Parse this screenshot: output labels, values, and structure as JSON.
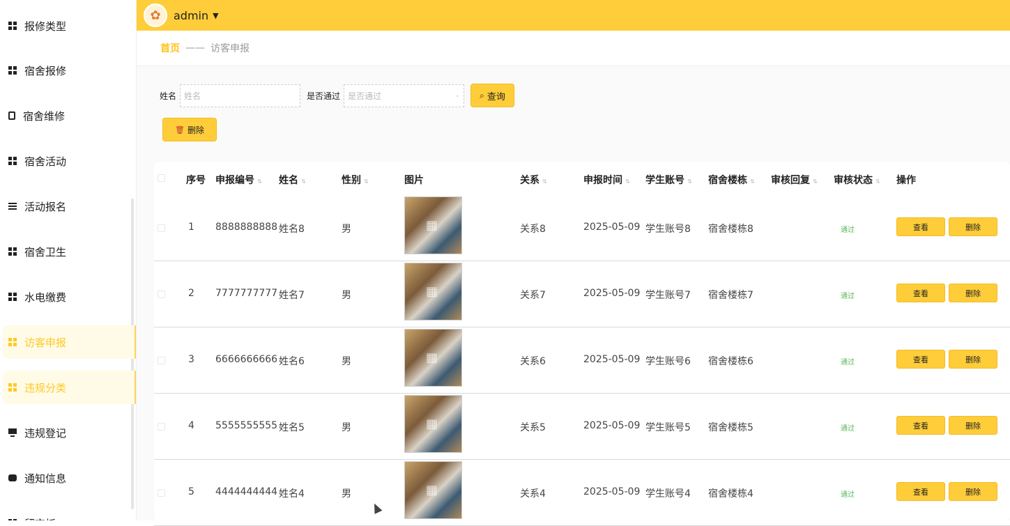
{
  "sidebar": {
    "items": [
      {
        "label": "报修类型",
        "icon": "grid-icon"
      },
      {
        "label": "宿舍报修",
        "icon": "grid-icon"
      },
      {
        "label": "宿舍维修",
        "icon": "clipboard-icon"
      },
      {
        "label": "宿舍活动",
        "icon": "grid-icon"
      },
      {
        "label": "活动报名",
        "icon": "list-icon"
      },
      {
        "label": "宿舍卫生",
        "icon": "grid-icon"
      },
      {
        "label": "水电缴费",
        "icon": "grid-icon"
      },
      {
        "label": "访客申报",
        "icon": "grid-icon",
        "active": true
      },
      {
        "label": "违规分类",
        "icon": "grid-icon",
        "active": true
      },
      {
        "label": "违规登记",
        "icon": "monitor-icon"
      },
      {
        "label": "通知信息",
        "icon": "chat-icon"
      },
      {
        "label": "留言板",
        "icon": "grid-icon"
      }
    ]
  },
  "header": {
    "username": "admin"
  },
  "breadcrumb": {
    "home": "首页",
    "separator": "——",
    "current": "访客申报"
  },
  "search": {
    "name_label": "姓名",
    "name_placeholder": "姓名",
    "pass_label": "是否通过",
    "pass_placeholder": "是否通过",
    "query_label": "查询"
  },
  "toolbar": {
    "delete_label": "删除"
  },
  "table": {
    "headers": [
      "序号",
      "申报编号",
      "姓名",
      "性别",
      "图片",
      "关系",
      "申报时间",
      "学生账号",
      "宿舍楼栋",
      "审核回复",
      "审核状态",
      "操作"
    ],
    "rows": [
      {
        "index": "1",
        "code": "8888888888",
        "name": "姓名8",
        "gender": "男",
        "relation": "关系8",
        "date": "2025-05-09",
        "account": "学生账号8",
        "building": "宿舍楼栋8",
        "reply": "",
        "status": "通过"
      },
      {
        "index": "2",
        "code": "7777777777",
        "name": "姓名7",
        "gender": "男",
        "relation": "关系7",
        "date": "2025-05-09",
        "account": "学生账号7",
        "building": "宿舍楼栋7",
        "reply": "",
        "status": "通过"
      },
      {
        "index": "3",
        "code": "6666666666",
        "name": "姓名6",
        "gender": "男",
        "relation": "关系6",
        "date": "2025-05-09",
        "account": "学生账号6",
        "building": "宿舍楼栋6",
        "reply": "",
        "status": "通过"
      },
      {
        "index": "4",
        "code": "5555555555",
        "name": "姓名5",
        "gender": "男",
        "relation": "关系5",
        "date": "2025-05-09",
        "account": "学生账号5",
        "building": "宿舍楼栋5",
        "reply": "",
        "status": "通过"
      },
      {
        "index": "5",
        "code": "4444444444",
        "name": "姓名4",
        "gender": "男",
        "relation": "关系4",
        "date": "2025-05-09",
        "account": "学生账号4",
        "building": "宿舍楼栋4",
        "reply": "",
        "status": "通过"
      }
    ],
    "view_label": "查看",
    "delete_label": "删除"
  },
  "colors": {
    "accent": "#ffcd3a",
    "active_text": "#ffc926",
    "status_ok": "#5cb85c"
  }
}
